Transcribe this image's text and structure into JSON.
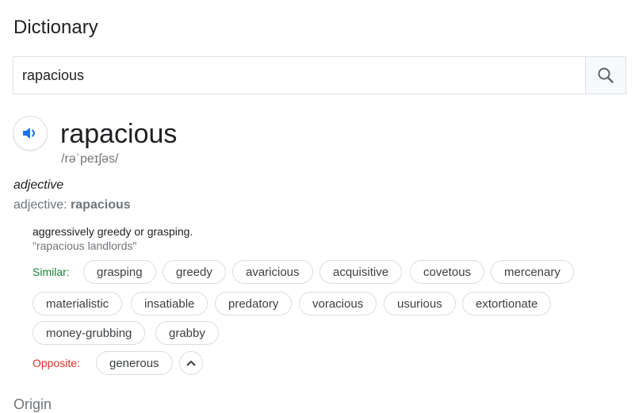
{
  "header": {
    "title": "Dictionary"
  },
  "search": {
    "value": "rapacious"
  },
  "entry": {
    "word": "rapacious",
    "phonetic": "/rəˈpeɪʃəs/",
    "part_of_speech": "adjective",
    "pos_prefix": "adjective: ",
    "pos_word": "rapacious",
    "definition": "aggressively greedy or grasping.",
    "example": "\"rapacious landlords\"",
    "similar_label": "Similar:",
    "similar": [
      "grasping",
      "greedy",
      "avaricious",
      "acquisitive",
      "covetous",
      "mercenary",
      "materialistic",
      "insatiable",
      "predatory",
      "voracious",
      "usurious",
      "extortionate",
      "money-grubbing",
      "grabby"
    ],
    "opposite_label": "Opposite:",
    "opposite": [
      "generous"
    ]
  },
  "origin": {
    "heading": "Origin"
  },
  "icons": {
    "search": "search-icon",
    "audio": "speaker-icon",
    "collapse": "chevron-up-icon"
  },
  "colors": {
    "similar": "#188038",
    "opposite": "#d93025",
    "audio_icon": "#1a73e8"
  }
}
